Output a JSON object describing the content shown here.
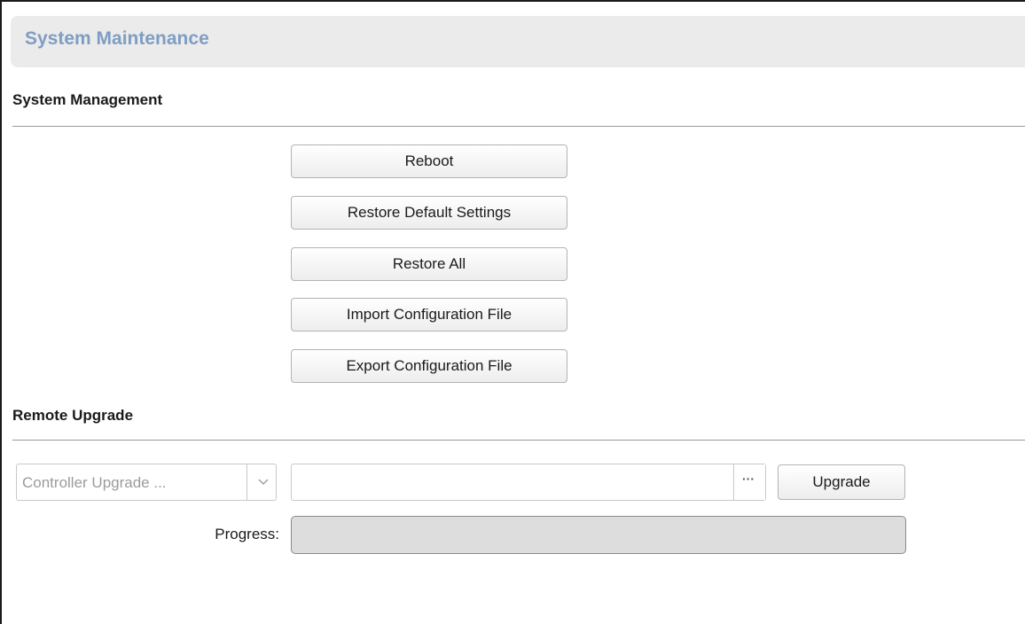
{
  "header": {
    "title": "System Maintenance",
    "title_color": "#7f9dc3"
  },
  "system_management": {
    "title": "System Management",
    "buttons": [
      {
        "label": "Reboot"
      },
      {
        "label": "Restore Default Settings"
      },
      {
        "label": "Restore All"
      },
      {
        "label": "Import Configuration File"
      },
      {
        "label": "Export Configuration File"
      }
    ]
  },
  "remote_upgrade": {
    "title": "Remote Upgrade",
    "upgrade_type": {
      "selected": "Controller Upgrade ..."
    },
    "file_path": {
      "value": "",
      "placeholder": ""
    },
    "browse_label": "···",
    "upgrade_label": "Upgrade",
    "progress_label": "Progress:",
    "progress_fraction": 0
  }
}
